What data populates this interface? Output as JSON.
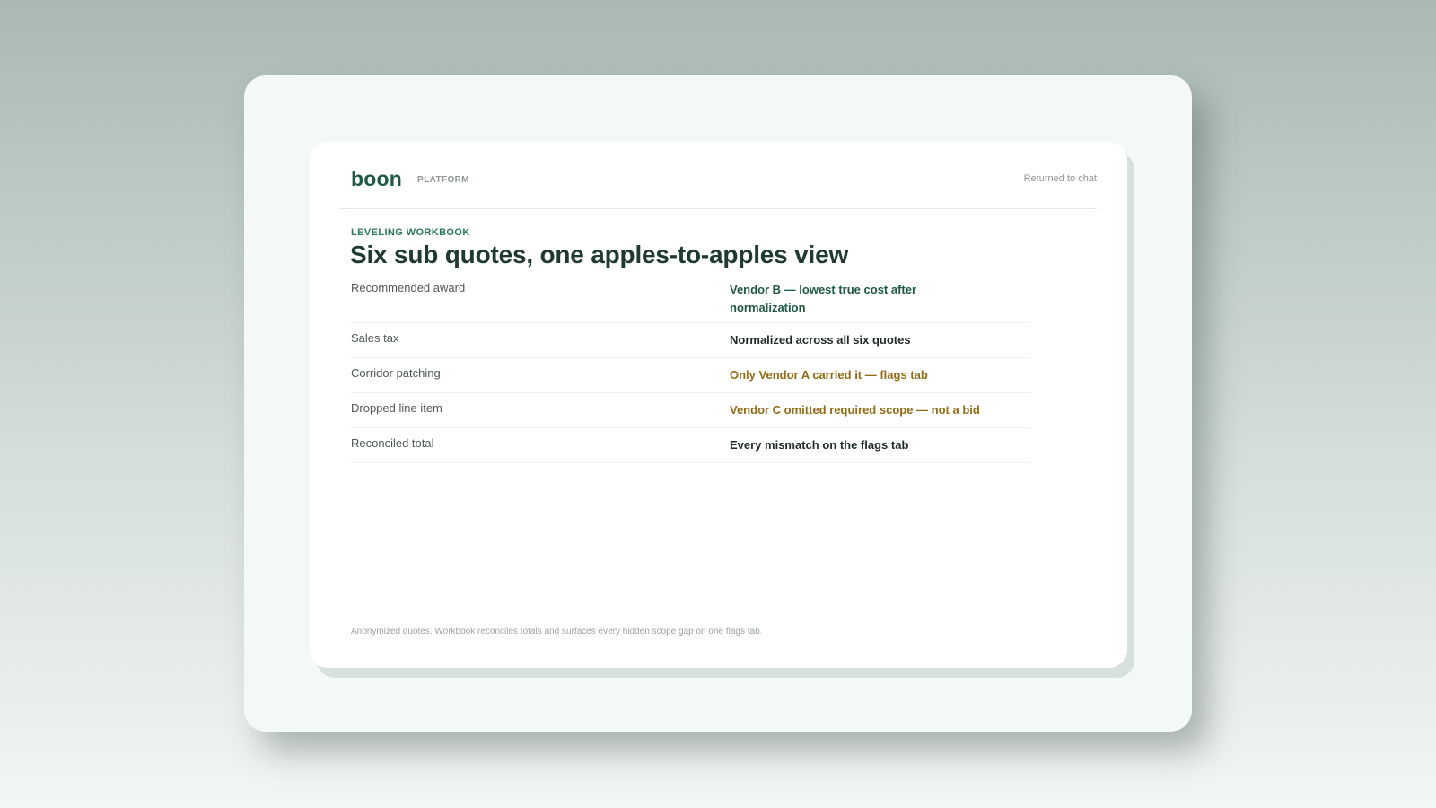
{
  "header": {
    "brand": "boon",
    "product": "PLATFORM",
    "status": "Returned to chat"
  },
  "workbook": {
    "eyebrow": "LEVELING WORKBOOK",
    "title": "Six sub quotes, one apples-to-apples view",
    "rows": [
      {
        "label": "Recommended award",
        "value": "Vendor B — lowest true cost after normalization",
        "tone": "green"
      },
      {
        "label": "Sales tax",
        "value": "Normalized across all six quotes",
        "tone": "dark"
      },
      {
        "label": "Corridor patching",
        "value": "Only Vendor A carried it — flags tab",
        "tone": "amber"
      },
      {
        "label": "Dropped line item",
        "value": "Vendor C omitted required scope — not a bid",
        "tone": "amber"
      },
      {
        "label": "Reconciled total",
        "value": "Every mismatch on the flags tab",
        "tone": "dark"
      }
    ],
    "footnote": "Anonymized quotes. Workbook reconciles totals and surfaces every hidden scope gap on one flags tab."
  },
  "colors": {
    "brand_green": "#1e5a40",
    "accent_green": "#2b7a57",
    "warning_amber": "#946a12",
    "title_dark": "#1f3a31"
  }
}
